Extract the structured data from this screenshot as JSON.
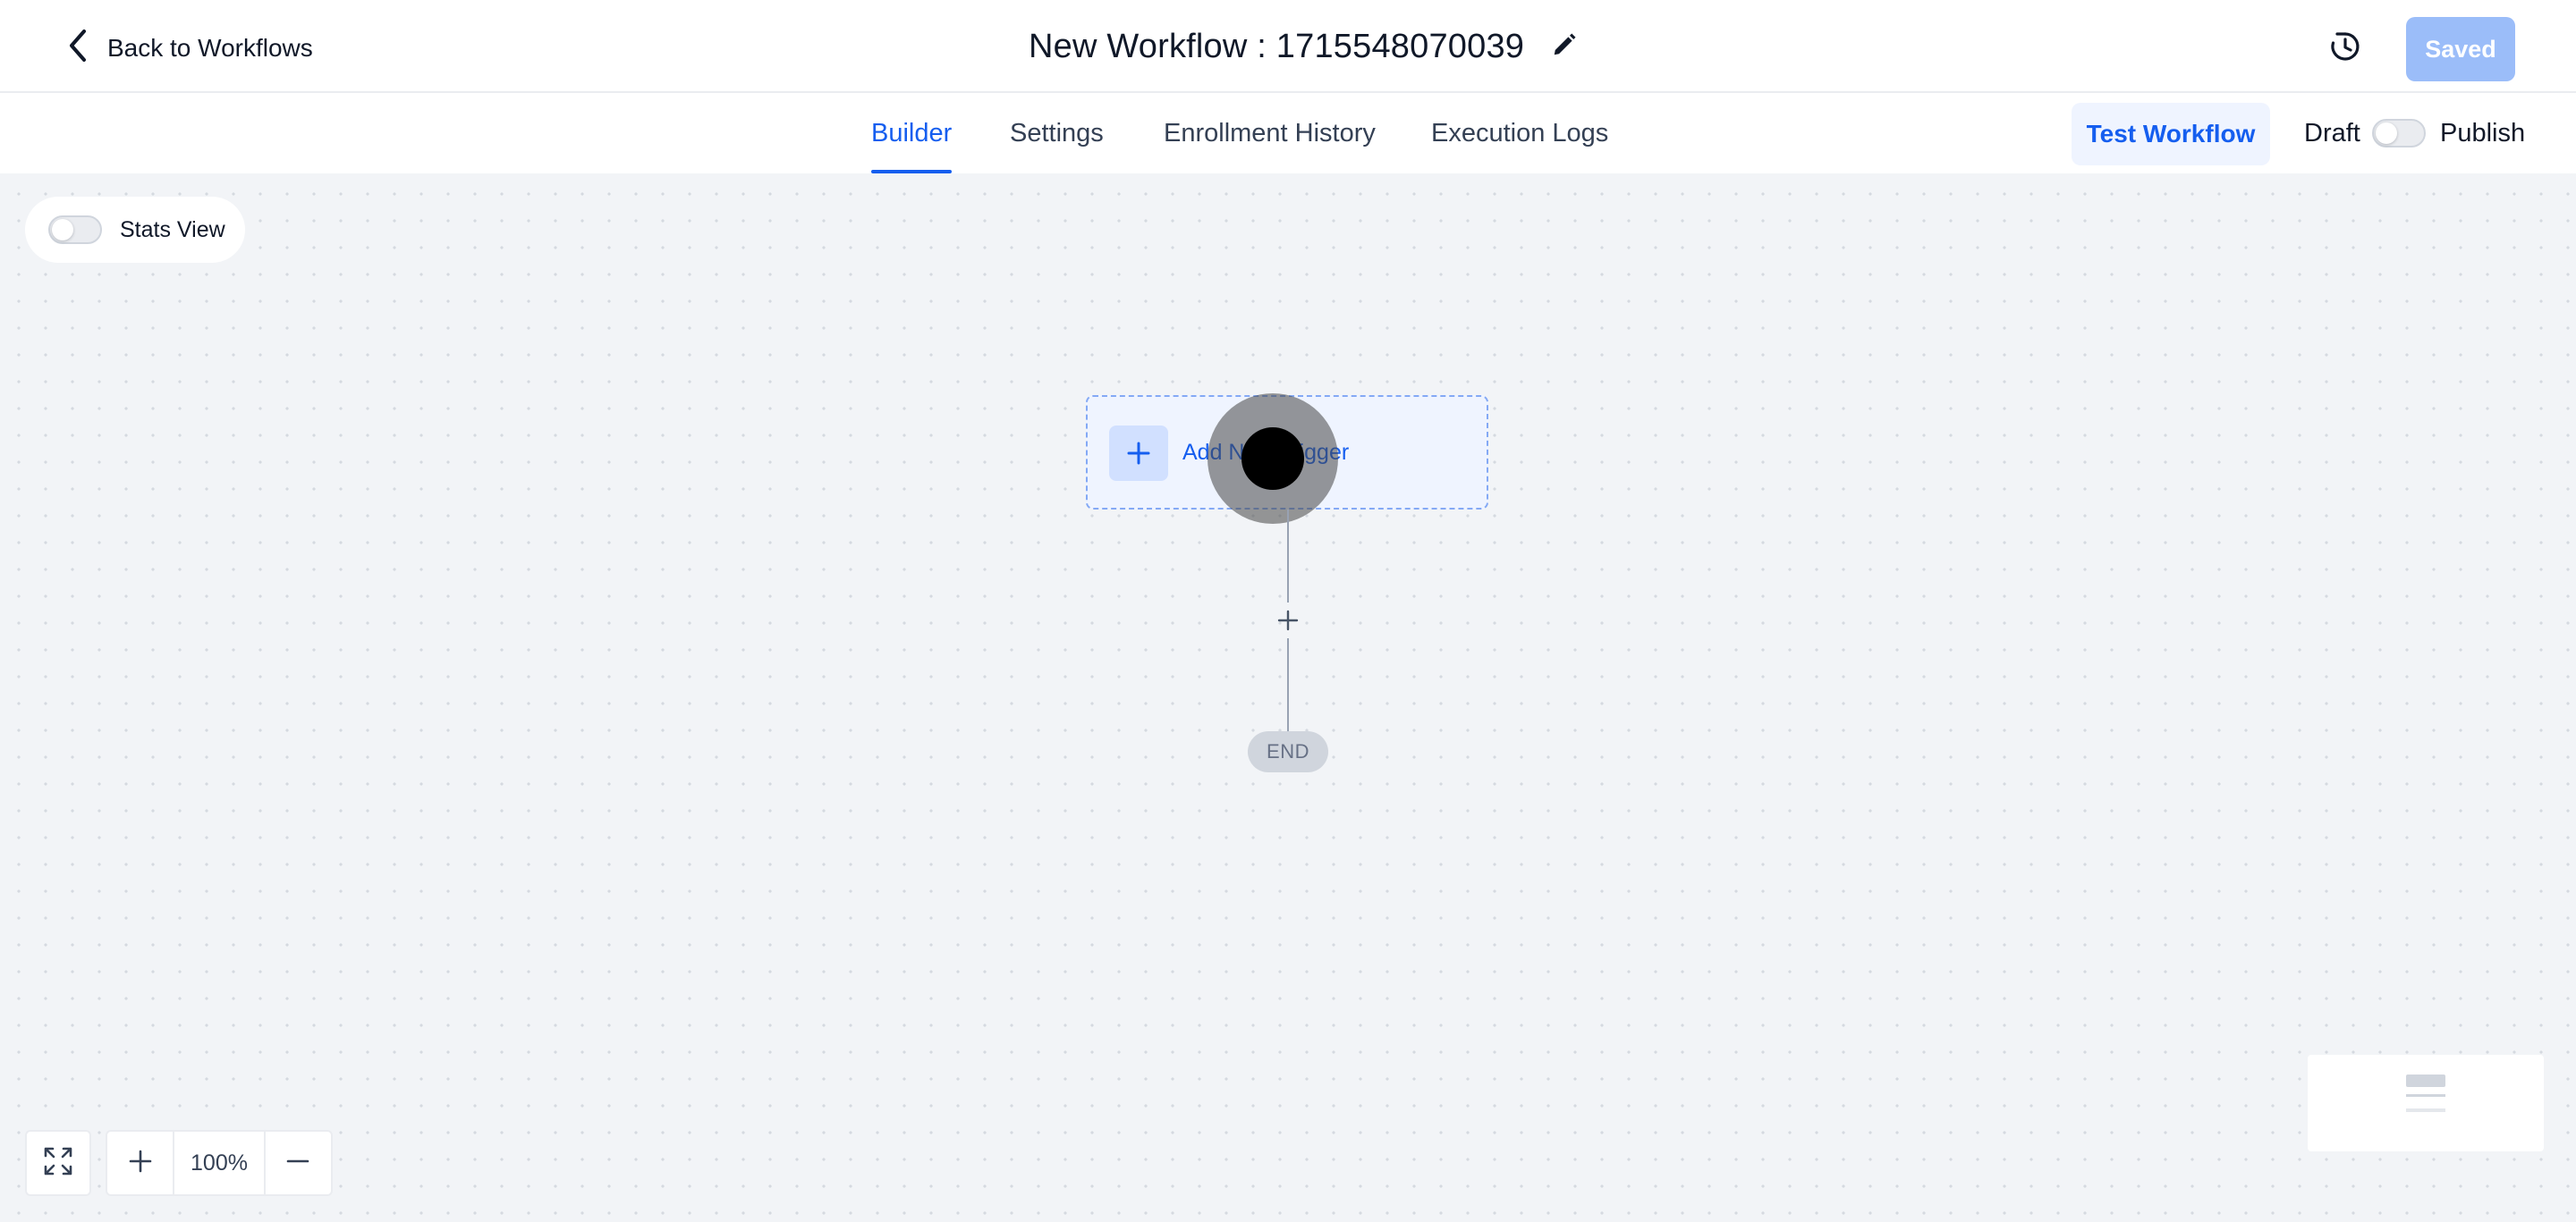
{
  "header": {
    "back_label": "Back to Workflows",
    "workflow_title": "New Workflow : 1715548070039",
    "saved_label": "Saved"
  },
  "tabs": [
    {
      "label": "Builder",
      "active": true
    },
    {
      "label": "Settings",
      "active": false
    },
    {
      "label": "Enrollment History",
      "active": false
    },
    {
      "label": "Execution Logs",
      "active": false
    }
  ],
  "actions": {
    "test_workflow_label": "Test Workflow",
    "draft_label": "Draft",
    "publish_label": "Publish",
    "publish_enabled": false
  },
  "canvas": {
    "stats_view_label": "Stats View",
    "stats_view_enabled": false,
    "trigger_label": "Add New Trigger",
    "end_label": "END",
    "zoom_level": "100%"
  },
  "icons": {
    "back": "chevron-left-icon",
    "edit": "pencil-icon",
    "history": "history-icon",
    "add": "plus-icon",
    "fit": "fullscreen-icon",
    "zoom_in": "plus-icon",
    "zoom_out": "minus-icon"
  },
  "colors": {
    "accent": "#155eef",
    "saved_button": "#9bbdf9",
    "canvas_bg": "#f2f4f7",
    "trigger_bg": "#eff4ff"
  }
}
